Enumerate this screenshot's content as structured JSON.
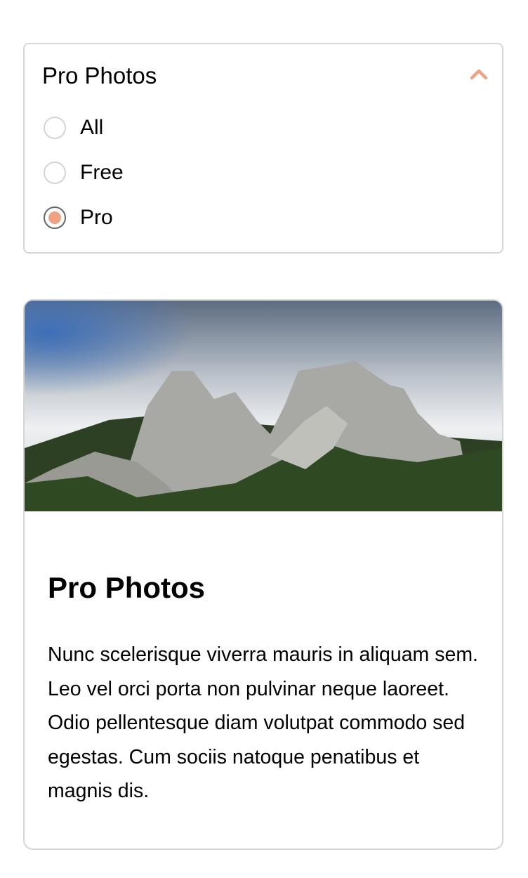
{
  "filter": {
    "title": "Pro Photos",
    "toggle_icon": "chevron-up-icon",
    "accent_color": "#f0a384",
    "options": [
      {
        "label": "All",
        "selected": false
      },
      {
        "label": "Free",
        "selected": false
      },
      {
        "label": "Pro",
        "selected": true
      }
    ]
  },
  "card": {
    "title": "Pro Photos",
    "text": "Nunc scelerisque viverra mauris in aliquam sem. Leo vel orci porta non pulvinar neque laoreet. Odio pellentesque diam volutpat commodo sed egestas. Cum sociis natoque penatibus et magnis dis."
  }
}
